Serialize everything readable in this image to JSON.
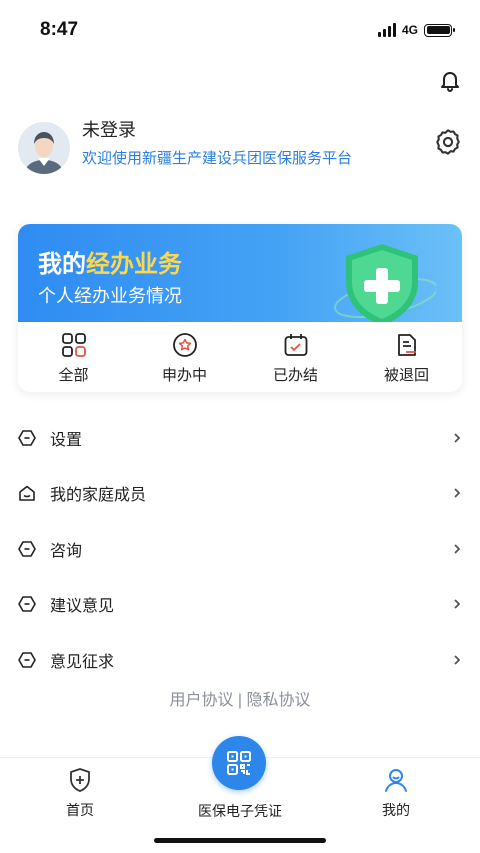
{
  "status_bar": {
    "time": "8:47",
    "network": "4G"
  },
  "profile": {
    "name": "未登录",
    "welcome": "欢迎使用新疆生产建设兵团医保服务平台"
  },
  "business": {
    "title_prefix": "我的",
    "title_highlight": "经办业务",
    "subtitle": "个人经办业务情况",
    "accent": "#ffd84a",
    "items": [
      {
        "label": "全部",
        "icon": "grid-icon"
      },
      {
        "label": "申办中",
        "icon": "star-circle-icon"
      },
      {
        "label": "已办结",
        "icon": "calendar-check-icon"
      },
      {
        "label": "被退回",
        "icon": "document-return-icon"
      }
    ]
  },
  "menu": [
    {
      "label": "设置",
      "icon": "hexagon-minus-icon"
    },
    {
      "label": "我的家庭成员",
      "icon": "house-icon"
    },
    {
      "label": "咨询",
      "icon": "hexagon-minus-icon"
    },
    {
      "label": "建议意见",
      "icon": "hexagon-minus-icon"
    },
    {
      "label": "意见征求",
      "icon": "hexagon-minus-icon"
    }
  ],
  "agreement": {
    "user": "用户协议",
    "separator": " | ",
    "privacy": "隐私协议"
  },
  "tabbar": {
    "home": "首页",
    "center": "医保电子凭证",
    "mine": "我的"
  },
  "colors": {
    "primary": "#2d86ea",
    "link": "#2b7fe0",
    "return_red": "#e5533f"
  }
}
